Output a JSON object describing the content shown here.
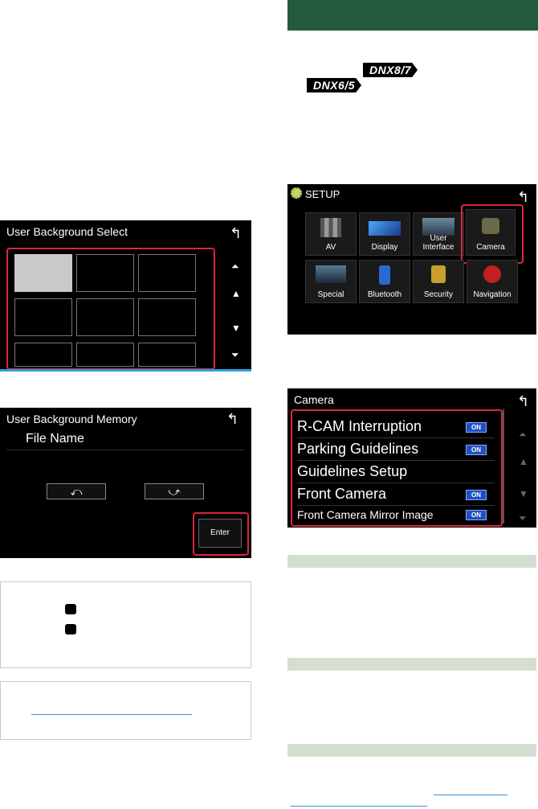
{
  "screen_bg_select": {
    "title": "User Background Select",
    "back_glyph": "↰",
    "scroll": {
      "top": "⏶",
      "up": "▲",
      "down": "▼",
      "bottom": "⏷"
    }
  },
  "screen_bg_memory": {
    "title": "User Background Memory",
    "file_name_label": "File Name",
    "rotate_left": "⤺",
    "rotate_right": "⤻",
    "enter_label": "Enter",
    "back_glyph": "↰"
  },
  "models": {
    "badge1": "DNX8/7",
    "badge2": "DNX6/5"
  },
  "setup_screen": {
    "title": "SETUP",
    "back_glyph": "↰",
    "items": [
      {
        "label": "AV",
        "icon": "av-icon"
      },
      {
        "label": "Display",
        "icon": "display-icon"
      },
      {
        "label": "User Interface",
        "icon": "user-interface-icon"
      },
      {
        "label": "Camera",
        "icon": "camera-icon"
      },
      {
        "label": "Special",
        "icon": "special-icon"
      },
      {
        "label": "Bluetooth",
        "icon": "bluetooth-icon"
      },
      {
        "label": "Security",
        "icon": "security-icon"
      },
      {
        "label": "Navigation",
        "icon": "navigation-icon"
      }
    ]
  },
  "camera_screen": {
    "title": "Camera",
    "back_glyph": "↰",
    "on_label": "ON",
    "items": [
      {
        "label": "R-CAM Interruption",
        "on": true
      },
      {
        "label": "Parking Guidelines",
        "on": true
      },
      {
        "label": "Guidelines Setup",
        "on": false
      },
      {
        "label": "Front Camera",
        "on": true
      },
      {
        "label": "Front Camera Mirror Image",
        "on": true
      }
    ]
  },
  "colors": {
    "accent_red": "#d9283c",
    "header_green": "#245b3c",
    "on_blue": "#2050c0"
  }
}
